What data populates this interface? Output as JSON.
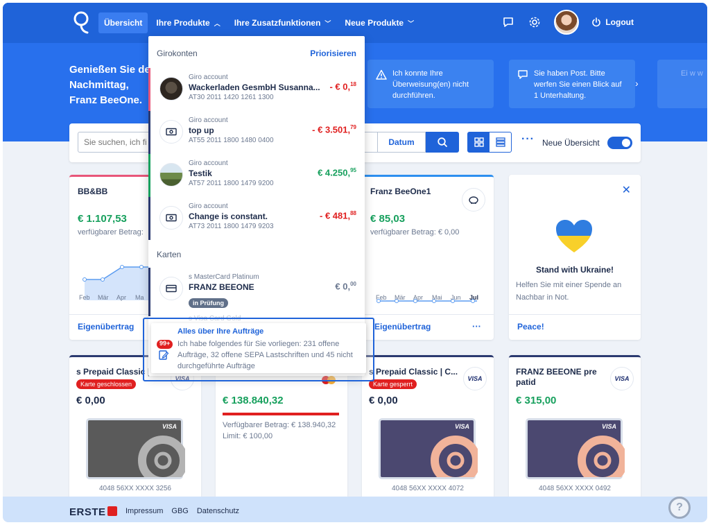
{
  "nav": {
    "items": [
      {
        "label": "Übersicht"
      },
      {
        "label": "Ihre Produkte"
      },
      {
        "label": "Ihre Zusatzfunktionen"
      },
      {
        "label": "Neue Produkte"
      }
    ],
    "logout": "Logout"
  },
  "hero": {
    "greeting_line1": "Genießen Sie de",
    "greeting_line2": "Nachmittag,",
    "greeting_line3": "Franz BeeOne.",
    "notice1": "Ich konnte Ihre Überweisung(en) nicht durchführen.",
    "notice2": "Sie haben Post. Bitte werfen Sie einen Blick auf 1 Unterhaltung.",
    "notice3": "Ei w w"
  },
  "search": {
    "placeholder": "Sie suchen, ich fi",
    "date_label": "Datum",
    "toggle_label": "Neue Übersicht"
  },
  "cards": {
    "bb": {
      "title": "BB&BB",
      "amount": "€ 1.107,53",
      "sub": "verfügbarer Betrag:",
      "months": [
        "Feb",
        "Mär",
        "Apr",
        "Ma"
      ],
      "link": "Eigenübertrag"
    },
    "franz": {
      "title": "Franz BeeOne1",
      "amount": "€ 85,03",
      "sub": "verfügbarer Betrag: € 0,00",
      "months": [
        "Feb",
        "Mär",
        "Apr",
        "Mai",
        "Jun",
        "Jul"
      ],
      "link": "Eigenübertrag"
    },
    "ukraine": {
      "title": "Stand with Ukraine!",
      "text": "Helfen Sie mit einer Spende an Nachbar in Not.",
      "link": "Peace!"
    },
    "prepaid1": {
      "title": "s Prepaid Classic |",
      "badge": "Karte geschlossen",
      "amount": "€ 0,00",
      "number": "4048 56XX XXXX 3256",
      "visa": "VISA"
    },
    "master": {
      "amount": "€ 138.840,32",
      "sub1": "Verfügbarer Betrag: € 138.940,32",
      "sub2": "Limit: € 100,00"
    },
    "prepaid2": {
      "title": "s Prepaid Classic | C...",
      "badge": "Karte gesperrt",
      "amount": "€ 0,00",
      "number": "4048 56XX XXXX 4072",
      "visa": "VISA"
    },
    "franzpre": {
      "title": "FRANZ BEEONE pre patid",
      "amount": "€ 315,00",
      "number": "4048 56XX XXXX 0492",
      "visa": "VISA"
    }
  },
  "dropdown": {
    "section1": "Girokonten",
    "action": "Priorisieren",
    "accounts": [
      {
        "type": "Giro account",
        "name": "Wackerladen GesmbH Susanna...",
        "iban": "AT30 2011 1420 1261 1300",
        "amount_main": "- € 0,",
        "amount_cents": "18"
      },
      {
        "type": "Giro account",
        "name": "top up",
        "iban": "AT55 2011 1800 1480 0400",
        "amount_main": "- € 3.501,",
        "amount_cents": "79"
      },
      {
        "type": "Giro account",
        "name": "Testik",
        "iban": "AT57 2011 1800 1479 9200",
        "amount_main": "€ 4.250,",
        "amount_cents": "95"
      },
      {
        "type": "Giro account",
        "name": "Change is constant.",
        "iban": "AT73 2011 1800 1479 9203",
        "amount_main": "- € 481,",
        "amount_cents": "88"
      }
    ],
    "section2": "Karten",
    "card": {
      "type": "s MasterCard Platinum",
      "name": "FRANZ BEEONE",
      "status": "in Prüfung",
      "amount_main": "€ 0,",
      "amount_cents": "00"
    },
    "faded": "s Visa Card Gold"
  },
  "tooltip": {
    "badge": "99+",
    "title": "Alles über Ihre Aufträge",
    "text": "Ich habe folgendes für Sie vorliegen: 231 offene Aufträge, 32 offene SEPA Lastschriften und 45 nicht durchgeführte Aufträge"
  },
  "footer": {
    "brand": "ERSTE",
    "links": [
      "Impressum",
      "GBG",
      "Datenschutz"
    ],
    "help": "?"
  },
  "colors": {
    "primary": "#1f63d9",
    "hero": "#2870ed",
    "positive": "#17a05d",
    "negative": "#e02020"
  }
}
